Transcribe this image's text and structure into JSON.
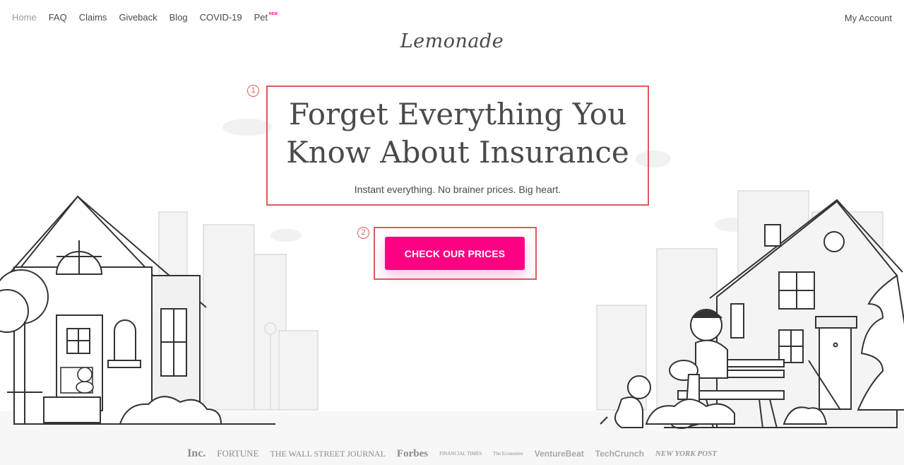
{
  "nav": {
    "items": [
      {
        "label": "Home"
      },
      {
        "label": "FAQ"
      },
      {
        "label": "Claims"
      },
      {
        "label": "Giveback"
      },
      {
        "label": "Blog"
      },
      {
        "label": "COVID-19"
      },
      {
        "label": "Pet",
        "badge": "NEW"
      }
    ],
    "account": "My Account"
  },
  "logo": "Lemonade",
  "hero": {
    "title_line1": "Forget Everything You",
    "title_line2": "Know About Insurance",
    "subtitle": "Instant everything. No brainer prices. Big heart."
  },
  "cta": {
    "label": "CHECK OUR PRICES"
  },
  "markers": [
    "1",
    "2"
  ],
  "press": [
    "Inc.",
    "FORTUNE",
    "THE WALL STREET JOURNAL",
    "Forbes",
    "FINANCIAL TIMES",
    "The Economist",
    "VentureBeat",
    "TechCrunch",
    "NEW YORK POST"
  ],
  "colors": {
    "accent": "#ff0083",
    "annotation": "#e05a5a",
    "text": "#4a4a4a"
  },
  "icons": [
    "house-illustration",
    "city-illustration",
    "person-on-bench-illustration",
    "dog-illustration",
    "cat-illustration"
  ]
}
